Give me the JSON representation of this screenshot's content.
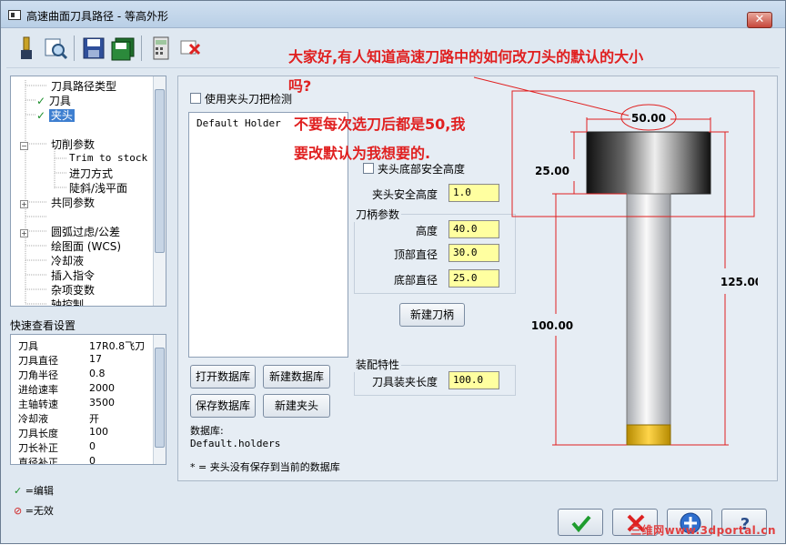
{
  "window": {
    "title": "高速曲面刀具路径 - 等高外形",
    "close_label": "✕"
  },
  "toolbar": {
    "icons": [
      "tool-library-icon",
      "preview-icon",
      "save-icon",
      "save-all-icon",
      "calculator-icon",
      "delete-icon"
    ]
  },
  "tree": {
    "items": [
      {
        "label": "刀具路径类型"
      },
      {
        "label": "刀具",
        "checked": true
      },
      {
        "label": "夹头",
        "checked": true,
        "selected": true
      },
      {
        "label": "切削参数"
      },
      {
        "label": "Trim to stock"
      },
      {
        "label": "进刀方式"
      },
      {
        "label": "陡斜/浅平面"
      },
      {
        "label": "共同参数"
      },
      {
        "label": "圆弧过虑/公差"
      },
      {
        "label": "绘图面 (WCS)"
      },
      {
        "label": "冷却液"
      },
      {
        "label": "插入指令"
      },
      {
        "label": "杂项变数"
      },
      {
        "label": "轴控制"
      }
    ]
  },
  "quick_view": {
    "title": "快速查看设置",
    "rows": [
      {
        "key": "刀具",
        "value": "17R0.8飞刀"
      },
      {
        "key": "刀具直径",
        "value": "17"
      },
      {
        "key": "刀角半径",
        "value": "0.8"
      },
      {
        "key": "进给速率",
        "value": "2000"
      },
      {
        "key": "主轴转速",
        "value": "3500"
      },
      {
        "key": "冷却液",
        "value": "开"
      },
      {
        "key": "刀具长度",
        "value": "100"
      },
      {
        "key": "刀长补正",
        "value": "0"
      },
      {
        "key": "直径补正",
        "value": "0"
      }
    ]
  },
  "legend": {
    "edit": "=编辑",
    "invalid": "=无效"
  },
  "holder": {
    "use_check_label": "使用夹头刀把检测",
    "list_item": "Default Holder",
    "open_db": "打开数据库",
    "new_db": "新建数据库",
    "save_db": "保存数据库",
    "new_holder": "新建夹头",
    "db_label": "数据库:",
    "db_name": "Default.holders",
    "footnote": "* = 夹头没有保存到当前的数据库"
  },
  "params": {
    "bottom_safety_label": "夹头底部安全高度",
    "safety_height_label": "夹头安全高度",
    "safety_height": "1.0",
    "shank_group": "刀柄参数",
    "height_label": "高度",
    "height": "40.0",
    "top_dia_label": "顶部直径",
    "top_dia": "30.0",
    "bottom_dia_label": "底部直径",
    "bottom_dia": "25.0",
    "new_shank": "新建刀柄",
    "assembly_group": "装配特性",
    "stickout_label": "刀具装夹长度",
    "stickout": "100.0"
  },
  "annotation": {
    "line1": "大家好,有人知道高速刀路中的如何改刀头的默认的大小",
    "line2": "吗?",
    "line3": "不要每次选刀后都是50,我",
    "line4": "要改默认为我想要的."
  },
  "diagram": {
    "holder_width": "50.00",
    "holder_height": "25.00",
    "total_length": "125.00",
    "tool_length": "100.00",
    "highlight_color": "#e02020"
  },
  "watermark": "三维网www.3dportal.cn"
}
